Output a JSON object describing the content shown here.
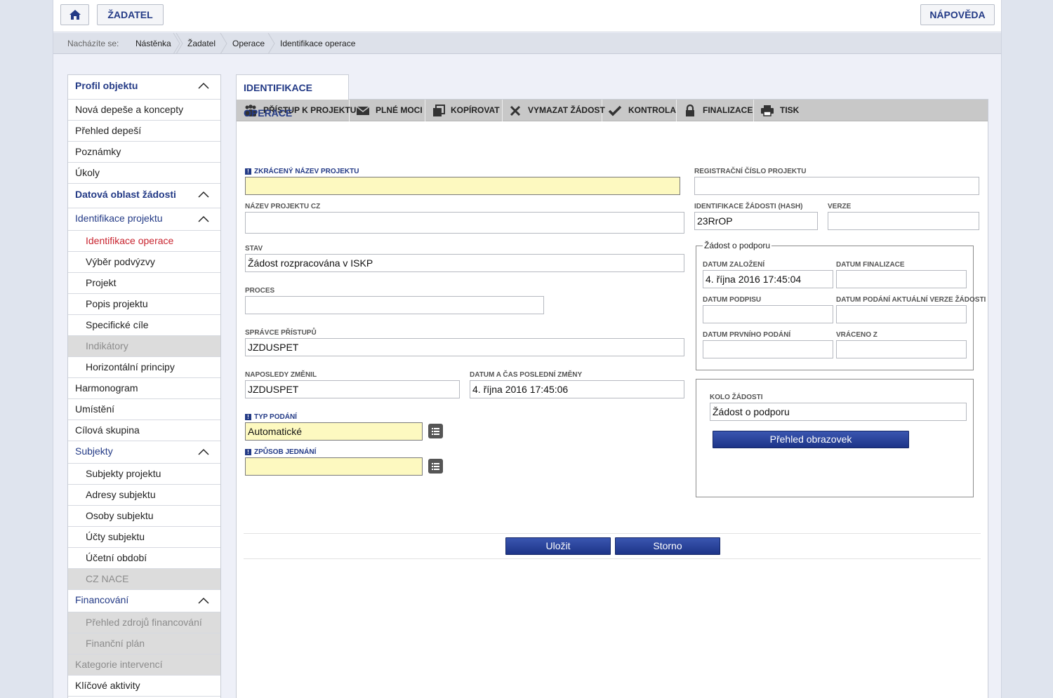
{
  "header": {
    "zadatel_label": "ŽADATEL",
    "help_label": "NÁPOVĚDA"
  },
  "breadcrumb": {
    "prefix": "Nacházíte se:",
    "items": [
      "Nástěnka",
      "Žadatel",
      "Operace",
      "Identifikace operace"
    ]
  },
  "sidebar": {
    "items": [
      {
        "label": "Profil objektu",
        "kind": "head"
      },
      {
        "label": "Nová depeše a koncepty",
        "kind": "item"
      },
      {
        "label": "Přehled depeší",
        "kind": "item"
      },
      {
        "label": "Poznámky",
        "kind": "item"
      },
      {
        "label": "Úkoly",
        "kind": "item"
      },
      {
        "label": "Datová oblast žádosti",
        "kind": "head"
      },
      {
        "label": "Identifikace projektu",
        "kind": "group"
      },
      {
        "label": "Identifikace operace",
        "kind": "sub-active"
      },
      {
        "label": "Výběr podvýzvy",
        "kind": "sub"
      },
      {
        "label": "Projekt",
        "kind": "sub"
      },
      {
        "label": "Popis projektu",
        "kind": "sub"
      },
      {
        "label": "Specifické cíle",
        "kind": "sub"
      },
      {
        "label": "Indikátory",
        "kind": "sub-disabled"
      },
      {
        "label": "Horizontální principy",
        "kind": "sub"
      },
      {
        "label": "Harmonogram",
        "kind": "item"
      },
      {
        "label": "Umístění",
        "kind": "item"
      },
      {
        "label": "Cílová skupina",
        "kind": "item"
      },
      {
        "label": "Subjekty",
        "kind": "group"
      },
      {
        "label": "Subjekty projektu",
        "kind": "sub"
      },
      {
        "label": "Adresy subjektu",
        "kind": "sub"
      },
      {
        "label": "Osoby subjektu",
        "kind": "sub"
      },
      {
        "label": "Účty subjektu",
        "kind": "sub"
      },
      {
        "label": "Účetní období",
        "kind": "sub"
      },
      {
        "label": "CZ NACE",
        "kind": "sub-disabled"
      },
      {
        "label": "Financování",
        "kind": "group"
      },
      {
        "label": "Přehled zdrojů financování",
        "kind": "sub-disabled"
      },
      {
        "label": "Finanční plán",
        "kind": "sub-disabled"
      },
      {
        "label": "Kategorie intervencí",
        "kind": "disabled"
      },
      {
        "label": "Klíčové aktivity",
        "kind": "item"
      }
    ]
  },
  "main": {
    "tab_title": "IDENTIFIKACE OPERACE",
    "toolbar": {
      "access": "PŘÍSTUP K PROJEKTU",
      "powers": "PLNÉ MOCI",
      "copy": "KOPÍROVAT",
      "delete": "VYMAZAT ŽÁDOST",
      "check": "KONTROLA",
      "finalize": "FINALIZACE",
      "print": "TISK"
    },
    "form": {
      "short_name_label": "ZKRÁCENÝ NÁZEV PROJEKTU",
      "short_name_value": "",
      "name_cz_label": "NÁZEV PROJEKTU CZ",
      "name_cz_value": "",
      "state_label": "STAV",
      "state_value": "Žádost rozpracována v ISKP",
      "process_label": "PROCES",
      "process_value": "",
      "access_admin_label": "SPRÁVCE PŘÍSTUPŮ",
      "access_admin_value": "JZDUSPET",
      "last_changed_by_label": "NAPOSLEDY ZMĚNIL",
      "last_changed_by_value": "JZDUSPET",
      "last_change_label": "DATUM A ČAS POSLEDNÍ ZMĚNY",
      "last_change_value": "4. října 2016 17:45:06",
      "submit_type_label": "TYP PODÁNÍ",
      "submit_type_value": "Automatické",
      "procedure_label": "ZPŮSOB JEDNÁNÍ",
      "procedure_value": "",
      "reg_number_label": "REGISTRAČNÍ ČÍSLO PROJEKTU",
      "reg_number_value": "",
      "hash_label": "IDENTIFIKACE ŽÁDOSTI (HASH)",
      "hash_value": "23RrOP",
      "version_label": "VERZE",
      "version_value": ""
    },
    "request_box": {
      "legend": "Žádost o podporu",
      "created_label": "DATUM ZALOŽENÍ",
      "created_value": "4. října 2016 17:45:04",
      "finalized_label": "DATUM FINALIZACE",
      "finalized_value": "",
      "signed_label": "DATUM PODPISU",
      "signed_value": "",
      "submitted_current_label": "DATUM PODÁNÍ AKTUÁLNÍ VERZE ŽÁDOSTI",
      "submitted_current_value": "",
      "first_submit_label": "DATUM PRVNÍHO PODÁNÍ",
      "first_submit_value": "",
      "returned_label": "VRÁCENO Z",
      "returned_value": ""
    },
    "round_box": {
      "round_label": "KOLO ŽÁDOSTI",
      "round_value": "Žádost o podporu",
      "overview_button": "Přehled obrazovek"
    },
    "actions": {
      "save": "Uložit",
      "cancel": "Storno"
    }
  },
  "colors": {
    "accent": "#233a86",
    "active": "#c8242f",
    "required_field": "#fdf9c0",
    "disabled_bg": "#dcdcdc"
  }
}
